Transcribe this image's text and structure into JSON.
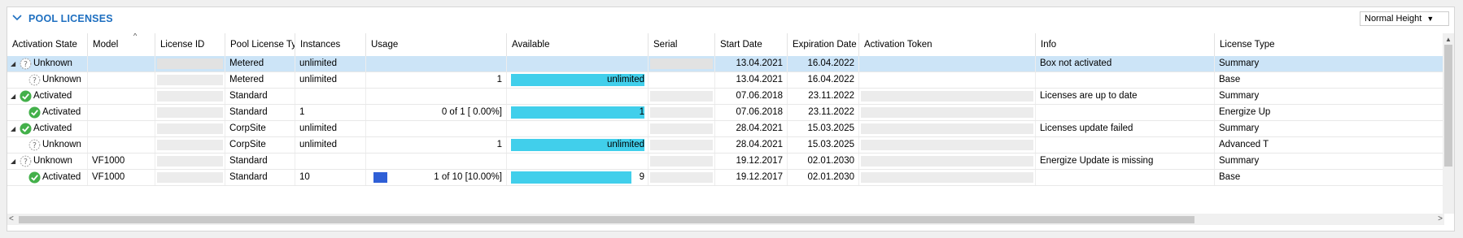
{
  "section": {
    "title": "POOL LICENSES"
  },
  "height_select": {
    "value": "Normal Height"
  },
  "columns": [
    "Activation State",
    "Model",
    "License ID",
    "Pool License Type",
    "Instances",
    "Usage",
    "Available",
    "Serial",
    "Start Date",
    "Expiration Date",
    "Activation Token",
    "Info",
    "License Type"
  ],
  "rows": [
    {
      "expander": "◢",
      "level": 0,
      "state": "Unknown",
      "state_icon": "question-icon",
      "model": "",
      "type": "Metered",
      "instances": "unlimited",
      "usage_text": "",
      "usage_fraction": null,
      "available_text": "",
      "available_fraction": null,
      "start": "13.04.2021",
      "expiration": "16.04.2022",
      "info": "Box not activated",
      "license_type": "Summary",
      "selected": true,
      "serial_box": true,
      "token_box": false
    },
    {
      "expander": "",
      "level": 1,
      "state": "Unknown",
      "state_icon": "question-icon",
      "model": "",
      "type": "Metered",
      "instances": "unlimited",
      "usage_text": "1",
      "usage_fraction": null,
      "available_text": "unlimited",
      "available_fraction": 1.0,
      "start": "13.04.2021",
      "expiration": "16.04.2022",
      "info": "",
      "license_type": "Base",
      "selected": false,
      "serial_box": false,
      "token_box": false
    },
    {
      "expander": "◢",
      "level": 0,
      "state": "Activated",
      "state_icon": "check-icon",
      "model": "",
      "type": "Standard",
      "instances": "",
      "usage_text": "",
      "usage_fraction": null,
      "available_text": "",
      "available_fraction": null,
      "start": "07.06.2018",
      "expiration": "23.11.2022",
      "info": "Licenses are up to date",
      "license_type": "Summary",
      "selected": false,
      "serial_box": true,
      "token_box": true
    },
    {
      "expander": "",
      "level": 1,
      "state": "Activated",
      "state_icon": "check-icon",
      "model": "",
      "type": "Standard",
      "instances": "1",
      "usage_text": "0 of 1 [ 0.00%]",
      "usage_fraction": 0,
      "available_text": "1",
      "available_fraction": 1.0,
      "start": "07.06.2018",
      "expiration": "23.11.2022",
      "info": "",
      "license_type": "Energize Up",
      "selected": false,
      "serial_box": true,
      "token_box": true
    },
    {
      "expander": "◢",
      "level": 0,
      "state": "Activated",
      "state_icon": "check-icon",
      "model": "",
      "type": "CorpSite",
      "instances": "unlimited",
      "usage_text": "",
      "usage_fraction": null,
      "available_text": "",
      "available_fraction": null,
      "start": "28.04.2021",
      "expiration": "15.03.2025",
      "info": "Licenses update failed",
      "license_type": "Summary",
      "selected": false,
      "serial_box": true,
      "token_box": true
    },
    {
      "expander": "",
      "level": 1,
      "state": "Unknown",
      "state_icon": "question-icon",
      "model": "",
      "type": "CorpSite",
      "instances": "unlimited",
      "usage_text": "1",
      "usage_fraction": null,
      "available_text": "unlimited",
      "available_fraction": 1.0,
      "start": "28.04.2021",
      "expiration": "15.03.2025",
      "info": "",
      "license_type": "Advanced T",
      "selected": false,
      "serial_box": true,
      "token_box": true
    },
    {
      "expander": "◢",
      "level": 0,
      "state": "Unknown",
      "state_icon": "question-icon",
      "model": "VF1000",
      "type": "Standard",
      "instances": "",
      "usage_text": "",
      "usage_fraction": null,
      "available_text": "",
      "available_fraction": null,
      "start": "19.12.2017",
      "expiration": "02.01.2030",
      "info": "Energize Update is missing",
      "license_type": "Summary",
      "selected": false,
      "serial_box": true,
      "token_box": true
    },
    {
      "expander": "",
      "level": 1,
      "state": "Activated",
      "state_icon": "check-icon",
      "model": "VF1000",
      "type": "Standard",
      "instances": "10",
      "usage_text": "1 of 10 [10.00%]",
      "usage_fraction": 0.1,
      "available_text": "9",
      "available_fraction": 0.9,
      "start": "19.12.2017",
      "expiration": "02.01.2030",
      "info": "",
      "license_type": "Base",
      "selected": false,
      "serial_box": true,
      "token_box": true
    }
  ],
  "colors": {
    "accent": "#1e6fc0",
    "available_bar": "#41cfeb",
    "usage_bar": "#2f5fd6",
    "selection": "#cce4f7",
    "check": "#43b04a"
  }
}
